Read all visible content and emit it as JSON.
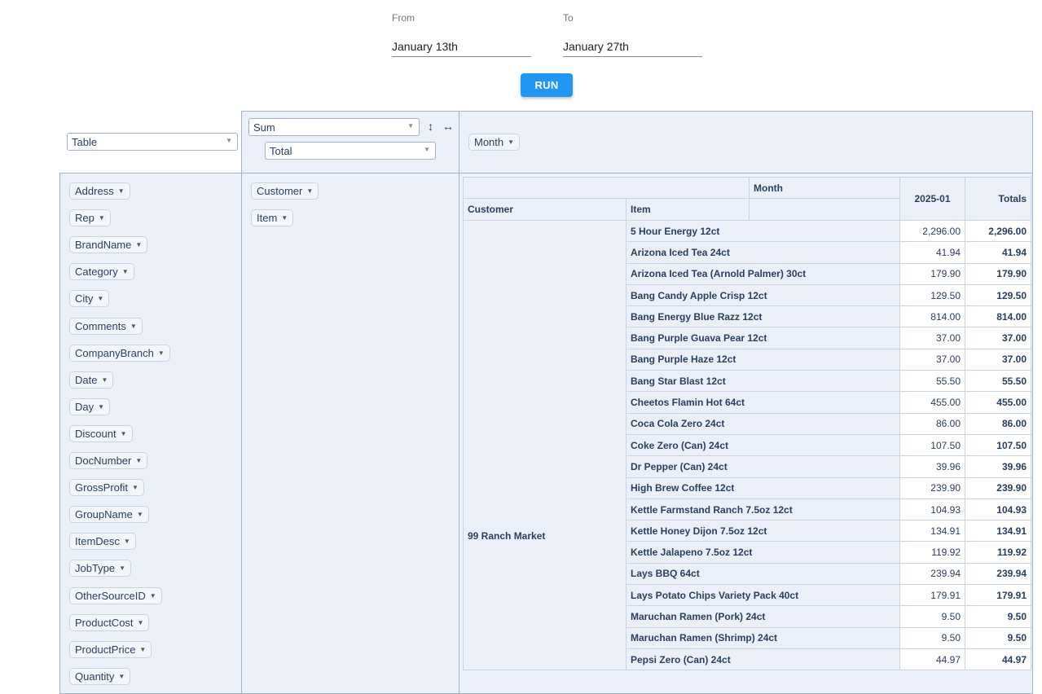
{
  "filters": {
    "from_label": "From",
    "from_value": "January 13th",
    "to_label": "To",
    "to_value": "January 27th",
    "run_label": "RUN"
  },
  "pivot": {
    "renderer": "Table",
    "aggregator": "Sum",
    "value_field": "Total",
    "sort_rows_icon": "↕",
    "sort_cols_icon": "↔",
    "col_fields": [
      "Month"
    ],
    "row_fields": [
      "Customer",
      "Item"
    ],
    "unused_fields": [
      "Address",
      "Rep",
      "BrandName",
      "Category",
      "City",
      "Comments",
      "CompanyBranch",
      "Date",
      "Day",
      "Discount",
      "DocNumber",
      "GrossProfit",
      "GroupName",
      "ItemDesc",
      "JobType",
      "OtherSourceID",
      "ProductCost",
      "ProductPrice",
      "Quantity"
    ]
  },
  "table": {
    "col_attr_label": "Month",
    "row_header_customer": "Customer",
    "row_header_item": "Item",
    "col_key": "2025-01",
    "totals_label": "Totals",
    "customer": "99 Ranch Market",
    "rows": [
      {
        "item": "5 Hour Energy 12ct",
        "value": "2,296.00",
        "total": "2,296.00"
      },
      {
        "item": "Arizona Iced Tea 24ct",
        "value": "41.94",
        "total": "41.94"
      },
      {
        "item": "Arizona Iced Tea (Arnold Palmer) 30ct",
        "value": "179.90",
        "total": "179.90"
      },
      {
        "item": "Bang Candy Apple Crisp 12ct",
        "value": "129.50",
        "total": "129.50"
      },
      {
        "item": "Bang Energy Blue Razz 12ct",
        "value": "814.00",
        "total": "814.00"
      },
      {
        "item": "Bang Purple Guava Pear 12ct",
        "value": "37.00",
        "total": "37.00"
      },
      {
        "item": "Bang Purple Haze 12ct",
        "value": "37.00",
        "total": "37.00"
      },
      {
        "item": "Bang Star Blast 12ct",
        "value": "55.50",
        "total": "55.50"
      },
      {
        "item": "Cheetos Flamin Hot 64ct",
        "value": "455.00",
        "total": "455.00"
      },
      {
        "item": "Coca Cola Zero 24ct",
        "value": "86.00",
        "total": "86.00"
      },
      {
        "item": "Coke Zero (Can) 24ct",
        "value": "107.50",
        "total": "107.50"
      },
      {
        "item": "Dr Pepper (Can) 24ct",
        "value": "39.96",
        "total": "39.96"
      },
      {
        "item": "High Brew Coffee 12ct",
        "value": "239.90",
        "total": "239.90"
      },
      {
        "item": "Kettle Farmstand Ranch 7.5oz 12ct",
        "value": "104.93",
        "total": "104.93"
      },
      {
        "item": "Kettle Honey Dijon 7.5oz 12ct",
        "value": "134.91",
        "total": "134.91"
      },
      {
        "item": "Kettle Jalapeno 7.5oz 12ct",
        "value": "119.92",
        "total": "119.92"
      },
      {
        "item": "Lays BBQ 64ct",
        "value": "239.94",
        "total": "239.94"
      },
      {
        "item": "Lays Potato Chips Variety Pack 40ct",
        "value": "179.91",
        "total": "179.91"
      },
      {
        "item": "Maruchan Ramen (Pork) 24ct",
        "value": "9.50",
        "total": "9.50"
      },
      {
        "item": "Maruchan Ramen (Shrimp) 24ct",
        "value": "9.50",
        "total": "9.50"
      },
      {
        "item": "Pepsi Zero (Can) 24ct",
        "value": "44.97",
        "total": "44.97"
      }
    ]
  }
}
